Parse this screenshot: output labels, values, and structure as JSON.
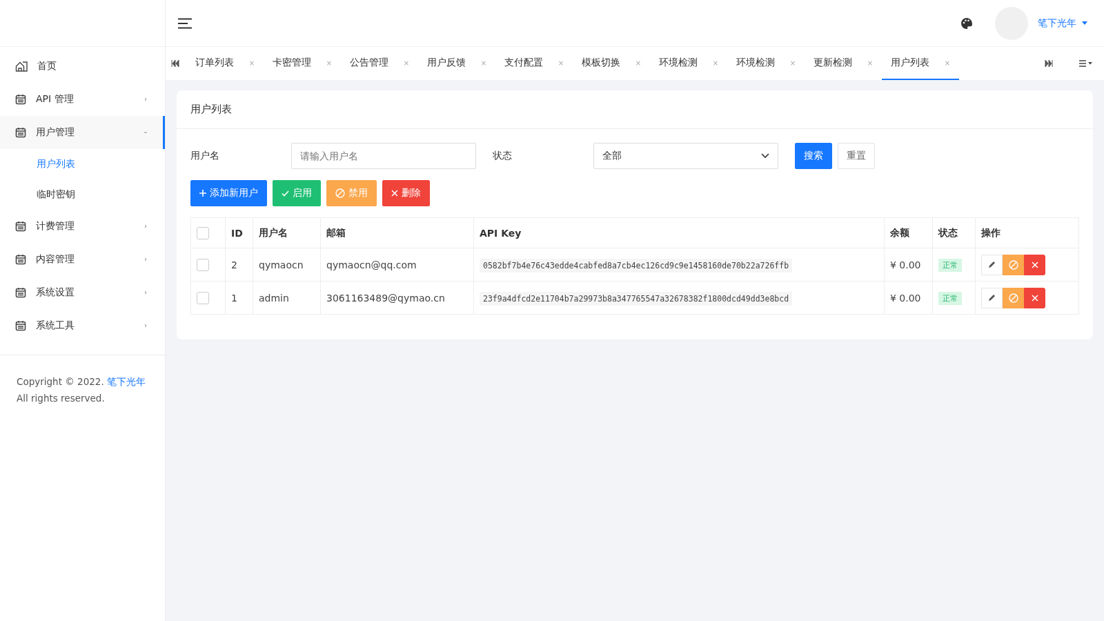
{
  "sidebar": {
    "items": [
      {
        "label": "首页",
        "kind": "link",
        "selected": false
      },
      {
        "label": "API 管理",
        "kind": "group",
        "expanded": false,
        "selected": false
      },
      {
        "label": "用户管理",
        "kind": "group",
        "expanded": true,
        "selected": true,
        "children": [
          {
            "label": "用户列表",
            "selected": true
          },
          {
            "label": "临时密钥",
            "selected": false
          }
        ]
      },
      {
        "label": "计费管理",
        "kind": "group",
        "expanded": false,
        "selected": false
      },
      {
        "label": "内容管理",
        "kind": "group",
        "expanded": false,
        "selected": false
      },
      {
        "label": "系统设置",
        "kind": "group",
        "expanded": false,
        "selected": false
      },
      {
        "label": "系统工具",
        "kind": "group",
        "expanded": false,
        "selected": false
      }
    ],
    "footer": {
      "before": "Copyright © 2022.",
      "link": "笔下光年",
      "after": "All rights reserved."
    }
  },
  "header": {
    "user": "笔下光年"
  },
  "tabs": [
    {
      "label": "订单列表",
      "selected": false
    },
    {
      "label": "卡密管理",
      "selected": false
    },
    {
      "label": "公告管理",
      "selected": false
    },
    {
      "label": "用户反馈",
      "selected": false
    },
    {
      "label": "支付配置",
      "selected": false
    },
    {
      "label": "模板切换",
      "selected": false
    },
    {
      "label": "环境检测",
      "selected": false
    },
    {
      "label": "环境检测",
      "selected": false
    },
    {
      "label": "更新检测",
      "selected": false
    },
    {
      "label": "用户列表",
      "selected": true
    }
  ],
  "tab_close": "×",
  "card": {
    "title": "用户列表",
    "filters": {
      "username_label": "用户名",
      "username_placeholder": "请输入用户名",
      "status_label": "状态",
      "status_value": "全部",
      "search": "搜索",
      "reset": "重置"
    },
    "actions": [
      {
        "label": "添加新用户",
        "kind": "add"
      },
      {
        "label": "启用",
        "kind": "enable"
      },
      {
        "label": "禁用",
        "kind": "disable"
      },
      {
        "label": "删除",
        "kind": "delete"
      }
    ],
    "table": {
      "columns": [
        "ID",
        "用户名",
        "邮箱",
        "API Key",
        "余额",
        "状态",
        "操作"
      ],
      "all_checked": false,
      "rows": [
        {
          "checked": false,
          "id": "2",
          "username": "qymaocn",
          "email": "qymaocn@qq.com",
          "api_key": "0582bf7b4e76c43edde4cabfed8a7cb4ec126cd9c9e1458160de70b22a726ffb",
          "balance": "¥ 0.00",
          "status": "正常"
        },
        {
          "checked": false,
          "id": "1",
          "username": "admin",
          "email": "3061163489@qymao.cn",
          "api_key": "23f9a4dfcd2e11704b7a29973b8a347765547a32678382f1800dcd49dd3e8bcd",
          "balance": "¥ 0.00",
          "status": "正常"
        }
      ]
    }
  }
}
